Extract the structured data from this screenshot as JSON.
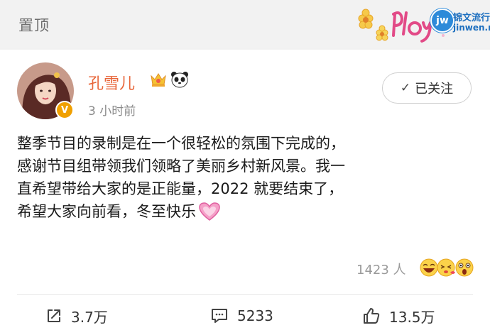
{
  "header": {
    "pinned_label": "置顶"
  },
  "watermark": {
    "logo_text": "jw",
    "site_name": "锦文流行语",
    "site_url": "jinwen.net"
  },
  "post": {
    "author": {
      "name": "孔雪儿",
      "verified": true,
      "accent_color": "#e8663a"
    },
    "time": "3 小时前",
    "follow_button": {
      "label": "已关注",
      "state": "following"
    },
    "body_lines": [
      "整季节目的录制是在一个很轻松的氛围下完成的，",
      "感谢节目组带领我们领略了美丽乡村新风景。我一",
      "直希望带给大家的是正能量，2022 就要结束了，",
      "希望大家向前看，冬至快乐"
    ],
    "body_trailing_emoji": "heart-emoji",
    "reactions": {
      "count": "1423 人",
      "emojis": [
        "laugh-emoji",
        "kiss-emoji",
        "surprise-emoji"
      ]
    },
    "actions": {
      "repost": "3.7万",
      "comment": "5233",
      "like": "13.5万"
    }
  }
}
